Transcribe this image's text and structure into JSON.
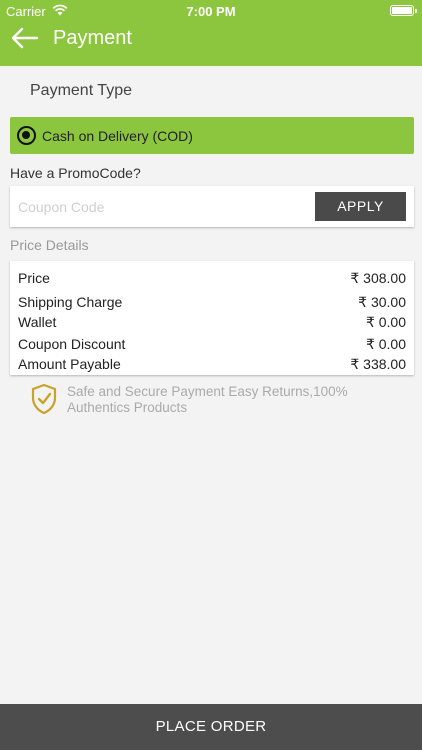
{
  "status_bar": {
    "carrier": "Carrier",
    "time": "7:00 PM"
  },
  "header": {
    "title": "Payment",
    "back_icon": "arrow-left-icon"
  },
  "payment_type": {
    "title": "Payment Type",
    "selected_option": "Cash on Delivery (COD)"
  },
  "promo": {
    "title": "Have a PromoCode?",
    "placeholder": "Coupon Code",
    "value": "",
    "apply_label": "APPLY"
  },
  "price_details": {
    "title": "Price Details",
    "rows": [
      {
        "label": "Price",
        "value": "₹ 308.00"
      },
      {
        "label": "Shipping Charge",
        "value": "₹ 30.00"
      },
      {
        "label": "Wallet",
        "value": "₹ 0.00"
      },
      {
        "label": "Coupon Discount",
        "value": "₹ 0.00"
      },
      {
        "label": "Amount Payable",
        "value": "₹ 338.00"
      }
    ]
  },
  "secure_note": {
    "icon": "shield-check-icon",
    "text": "Safe and Secure Payment Easy Returns,100% Authentics Products"
  },
  "footer": {
    "place_order_label": "PLACE ORDER"
  },
  "colors": {
    "accent_green": "#8cc63f",
    "dark_button": "#4d4d4d",
    "shield_gold": "#c9a227"
  }
}
